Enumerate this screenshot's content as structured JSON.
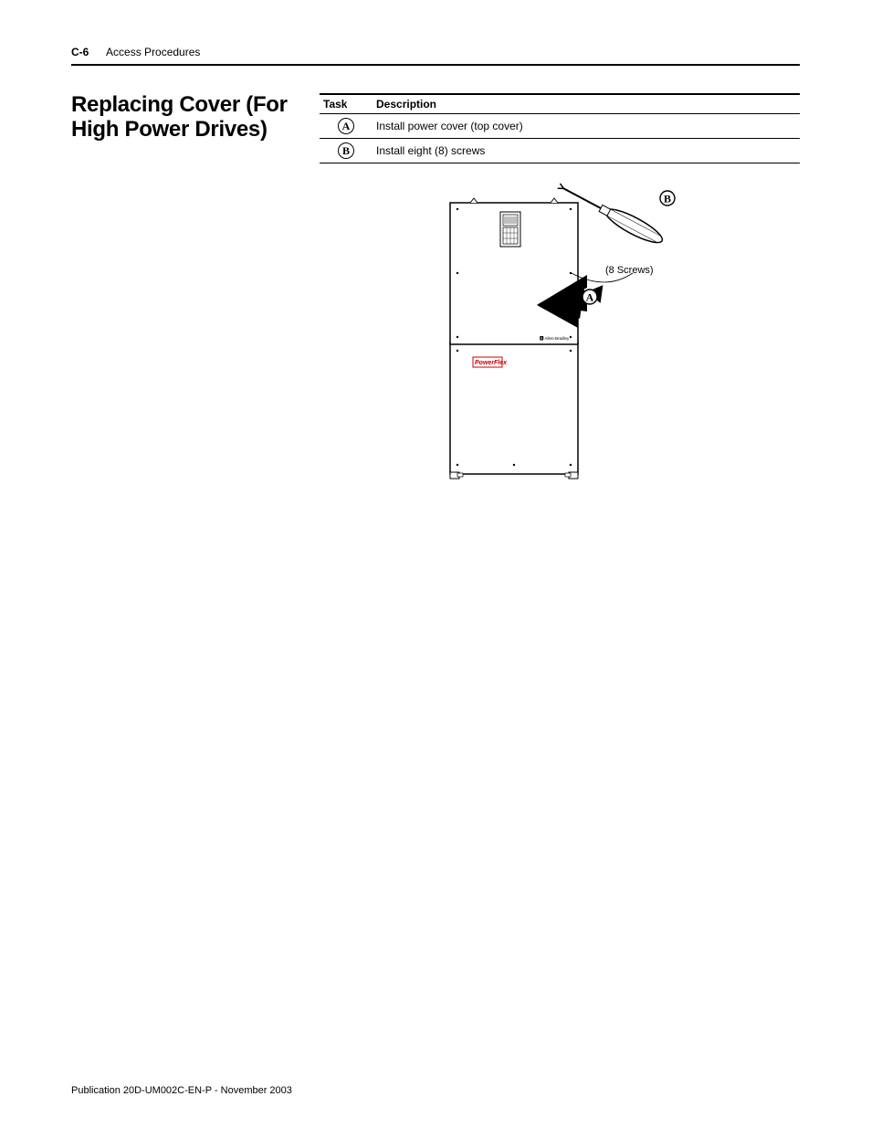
{
  "header": {
    "page_num": "C-6",
    "section": "Access Procedures"
  },
  "section_title": "Replacing Cover (For High Power Drives)",
  "table": {
    "col_task": "Task",
    "col_desc": "Description",
    "rows": [
      {
        "task_letter": "A",
        "description": "Install power cover (top cover)"
      },
      {
        "task_letter": "B",
        "description": "Install eight (8) screws"
      }
    ]
  },
  "figure": {
    "screws_label": "(8 Screws)",
    "callout_a": "A",
    "callout_b": "B",
    "logo_text": "PowerFlex",
    "brand_text": "Allen-Bradley"
  },
  "footer": "Publication 20D-UM002C-EN-P - November 2003"
}
